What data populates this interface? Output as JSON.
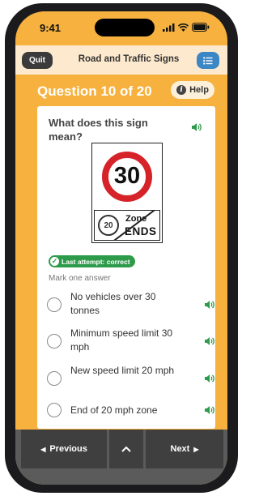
{
  "status_bar": {
    "time": "9:41"
  },
  "header": {
    "quit_label": "Quit",
    "title": "Road and Traffic Signs",
    "menu_icon": "list-icon"
  },
  "progress": {
    "label": "Question 10 of 20",
    "help_label": "Help"
  },
  "question": {
    "text": "What does this sign mean?",
    "sign": {
      "speed": "30",
      "zone_speed": "20",
      "zone_label": "Zone",
      "ends_label": "ENDS"
    },
    "last_attempt": "Last attempt: correct",
    "mark_label": "Mark one answer",
    "answers": [
      {
        "label": "No vehicles over 30 tonnes"
      },
      {
        "label": "Minimum speed limit 30 mph"
      },
      {
        "label": "New speed limit 20 mph"
      },
      {
        "label": "End of 20 mph zone"
      }
    ]
  },
  "footer": {
    "previous_label": "Previous",
    "next_label": "Next"
  },
  "colors": {
    "background": "#f6b13e",
    "header": "#fde9cd",
    "accent_blue": "#3b86c4",
    "correct_green": "#2e9b4a",
    "sign_red": "#d6232a",
    "footer": "#3f3f3f"
  }
}
